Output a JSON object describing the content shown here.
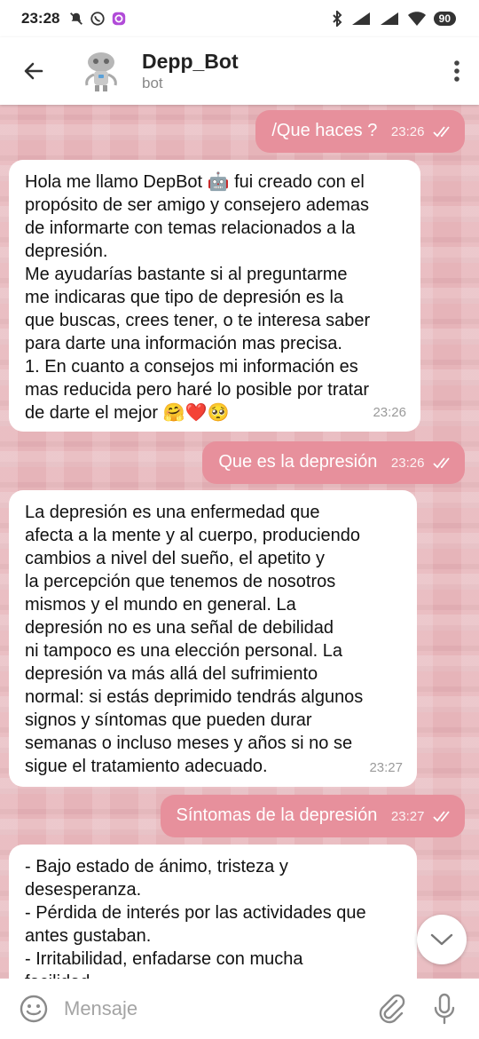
{
  "status_bar": {
    "time": "23:28",
    "battery": "90"
  },
  "header": {
    "back_icon": "arrow-left-icon",
    "title": "Depp_Bot",
    "subtitle": "bot",
    "menu_icon": "more-vertical-icon"
  },
  "messages": [
    {
      "direction": "out",
      "text": "/Que haces ?",
      "time": "23:26",
      "status": "read"
    },
    {
      "direction": "in",
      "text": "Hola me llamo DepBot 🤖 fui creado con el\npropósito de ser amigo y consejero ademas\nde informarte con temas relacionados a la\ndepresión.\nMe ayudarías bastante si al preguntarme\nme indicaras que tipo de depresión es la\nque buscas, crees tener, o te interesa saber\npara darte una información mas precisa.\n1. En cuanto a consejos mi información es\nmas reducida pero haré lo posible por tratar\nde darte el mejor 🤗❤️🥺",
      "time": "23:26"
    },
    {
      "direction": "out",
      "text": "Que es la depresión",
      "time": "23:26",
      "status": "read"
    },
    {
      "direction": "in",
      "text": "La depresión es una enfermedad que\nafecta a la mente y al cuerpo, produciendo\ncambios a nivel del sueño, el apetito y\nla percepción que tenemos de nosotros\nmismos y el mundo en general. La\ndepresión no es una señal de debilidad\nni tampoco es una elección personal. La\ndepresión va más allá del sufrimiento\nnormal: si estás deprimido tendrás algunos\nsignos y síntomas que pueden durar\nsemanas o incluso meses y años si no se\nsigue el tratamiento adecuado.",
      "time": "23:27"
    },
    {
      "direction": "out",
      "text": "Síntomas de la depresión",
      "time": "23:27",
      "status": "read"
    },
    {
      "direction": "in",
      "text": "- Bajo estado de ánimo, tristeza y\ndesesperanza.\n - Pérdida de interés por las actividades que\nantes gustaban.\n - Irritabilidad, enfadarse con mucha\nfacilidad.",
      "time": ""
    }
  ],
  "composer": {
    "placeholder": "Mensaje",
    "emoji_icon": "smiley-icon",
    "attach_icon": "paperclip-icon",
    "mic_icon": "microphone-icon"
  },
  "scroll_down_icon": "chevron-down-icon"
}
